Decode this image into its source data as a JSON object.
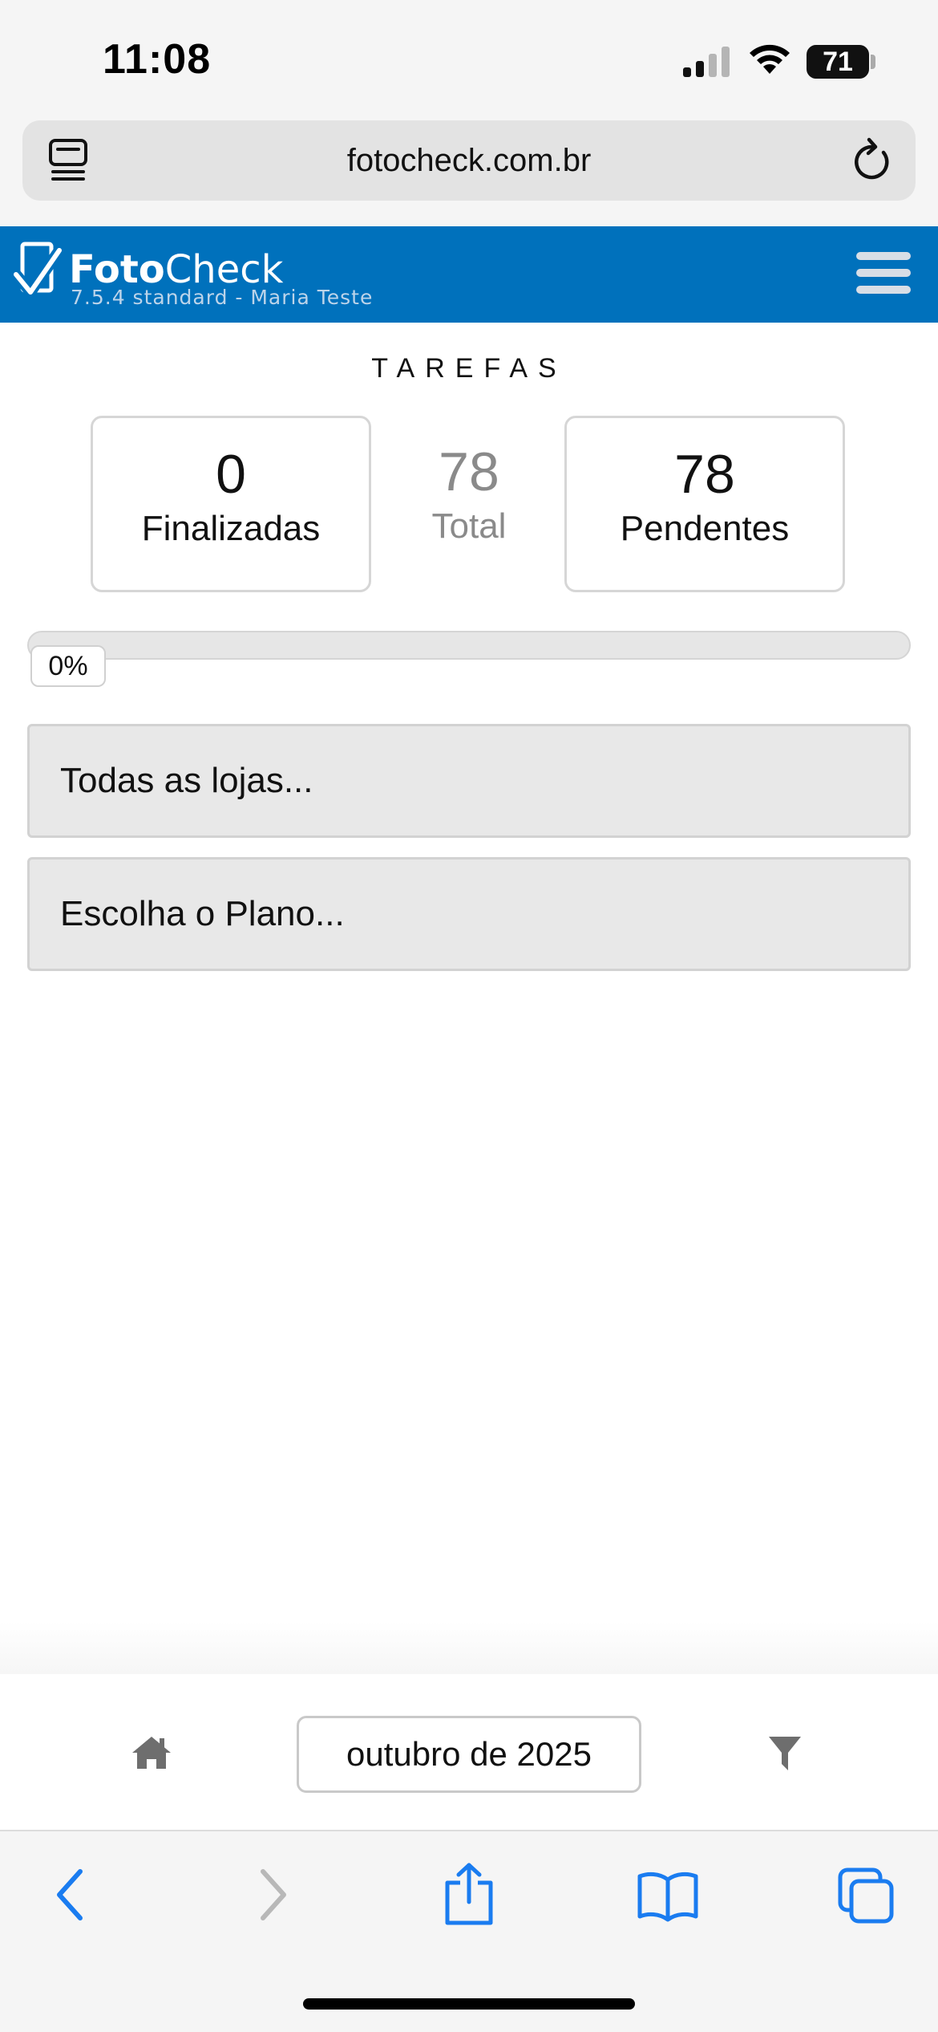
{
  "status_bar": {
    "time": "11:08",
    "battery": "71",
    "signal_icon": "cellular-signal-icon",
    "wifi_icon": "wifi-icon"
  },
  "browser": {
    "url": "fotocheck.com.br",
    "reader_icon": "reader-mode-icon",
    "reload_icon": "reload-icon"
  },
  "header": {
    "logo_bold": "Foto",
    "logo_regular": "Check",
    "version": "7.5.4 standard - Maria Teste",
    "menu_icon": "hamburger-menu-icon",
    "brand_color": "#0071bc"
  },
  "tasks": {
    "title": "TAREFAS",
    "finished_count": "0",
    "finished_label": "Finalizadas",
    "total_count": "78",
    "total_label": "Total",
    "pending_count": "78",
    "pending_label": "Pendentes",
    "progress_percent": 0,
    "progress_label": "0%"
  },
  "filters": {
    "stores_select": "Todas as lojas...",
    "plan_select": "Escolha o Plano..."
  },
  "footer": {
    "home_icon": "home-icon",
    "month_label": "outubro de 2025",
    "filter_icon": "filter-icon"
  },
  "safari_toolbar": {
    "icons": [
      "back-icon",
      "forward-icon",
      "share-icon",
      "bookmarks-icon",
      "tabs-icon"
    ]
  }
}
